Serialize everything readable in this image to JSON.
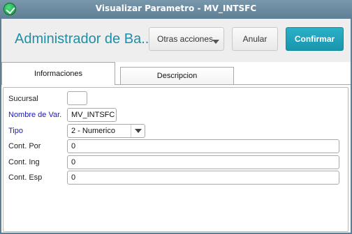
{
  "window": {
    "title": "Visualizar Parametro - MV_INTSFC"
  },
  "header": {
    "title": "Administrador de Ba...",
    "more_actions_label": "Otras acciones",
    "cancel_label": "Anular",
    "confirm_label": "Confirmar"
  },
  "tabs": [
    {
      "label": "Informaciones",
      "active": true
    },
    {
      "label": "Descripcion",
      "active": false
    }
  ],
  "form": {
    "sucursal": {
      "label": "Sucursal",
      "value": ""
    },
    "nombre_var": {
      "label": "Nombre de Var.",
      "value": "MV_INTSFC"
    },
    "tipo": {
      "label": "Tipo",
      "value": "2 - Numerico"
    },
    "cont_por": {
      "label": "Cont. Por",
      "value": "0"
    },
    "cont_ing": {
      "label": "Cont. Ing",
      "value": "0"
    },
    "cont_esp": {
      "label": "Cont. Esp",
      "value": "0"
    }
  },
  "colors": {
    "title_accent": "#1e8fa8",
    "confirm_button": "#1896ad",
    "required_label": "#1b1bb5",
    "titlebar": "#5f7f94"
  }
}
